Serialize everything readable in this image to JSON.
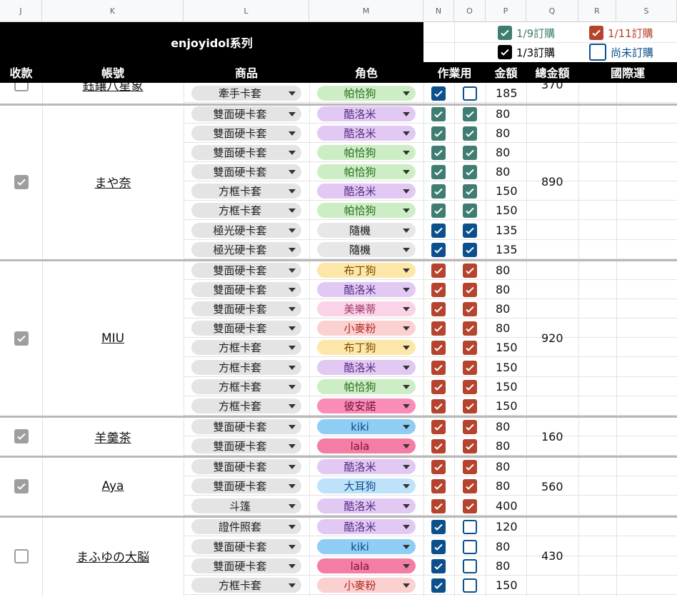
{
  "columns": [
    "J",
    "K",
    "L",
    "M",
    "N",
    "O",
    "P",
    "Q",
    "R",
    "S"
  ],
  "title": "enjoyidol系列",
  "legend": [
    {
      "label": "1/9訂購",
      "color": "#3f7d73",
      "state": "checked"
    },
    {
      "label": "1/11訂購",
      "color": "#b5432d",
      "state": "checked"
    },
    {
      "label": "1/3訂購",
      "color": "#000000",
      "state": "checked"
    },
    {
      "label": "尚未訂購",
      "color": "#0b4f8c",
      "state": "unchecked"
    }
  ],
  "headers": {
    "paid": "收款",
    "account": "帳號",
    "product": "商品",
    "character": "角色",
    "work": "作業用",
    "amount": "金額",
    "total": "總金額",
    "intl": "國際運"
  },
  "rows": [
    {
      "product": "牽手卡套",
      "character": "帕恰狗",
      "n": "blue-on",
      "o": "blue-off",
      "amount": "185"
    },
    {
      "product": "雙面硬卡套",
      "character": "酷洛米",
      "n": "teal-on",
      "o": "teal-on",
      "amount": "80"
    },
    {
      "product": "雙面硬卡套",
      "character": "酷洛米",
      "n": "teal-on",
      "o": "teal-on",
      "amount": "80"
    },
    {
      "product": "雙面硬卡套",
      "character": "帕恰狗",
      "n": "teal-on",
      "o": "teal-on",
      "amount": "80"
    },
    {
      "product": "雙面硬卡套",
      "character": "帕恰狗",
      "n": "teal-on",
      "o": "teal-on",
      "amount": "80"
    },
    {
      "product": "方框卡套",
      "character": "酷洛米",
      "n": "teal-on",
      "o": "teal-on",
      "amount": "150"
    },
    {
      "product": "方框卡套",
      "character": "帕恰狗",
      "n": "teal-on",
      "o": "teal-on",
      "amount": "150"
    },
    {
      "product": "極光硬卡套",
      "character": "隨機",
      "n": "blue-on",
      "o": "blue-on",
      "amount": "135"
    },
    {
      "product": "極光硬卡套",
      "character": "隨機",
      "n": "blue-on",
      "o": "blue-on",
      "amount": "135"
    },
    {
      "product": "雙面硬卡套",
      "character": "布丁狗",
      "n": "red-on",
      "o": "red-on",
      "amount": "80"
    },
    {
      "product": "雙面硬卡套",
      "character": "酷洛米",
      "n": "red-on",
      "o": "red-on",
      "amount": "80"
    },
    {
      "product": "雙面硬卡套",
      "character": "美樂蒂",
      "n": "red-on",
      "o": "red-on",
      "amount": "80"
    },
    {
      "product": "雙面硬卡套",
      "character": "小麥粉",
      "n": "red-on",
      "o": "red-on",
      "amount": "80"
    },
    {
      "product": "方框卡套",
      "character": "布丁狗",
      "n": "red-on",
      "o": "red-on",
      "amount": "150"
    },
    {
      "product": "方框卡套",
      "character": "酷洛米",
      "n": "red-on",
      "o": "red-on",
      "amount": "150"
    },
    {
      "product": "方框卡套",
      "character": "帕恰狗",
      "n": "red-on",
      "o": "red-on",
      "amount": "150"
    },
    {
      "product": "方框卡套",
      "character": "彼安諾",
      "n": "red-on",
      "o": "red-on",
      "amount": "150"
    },
    {
      "product": "雙面硬卡套",
      "character": "kiki",
      "n": "red-on",
      "o": "red-on",
      "amount": "80"
    },
    {
      "product": "雙面硬卡套",
      "character": "lala",
      "n": "red-on",
      "o": "red-on",
      "amount": "80"
    },
    {
      "product": "雙面硬卡套",
      "character": "酷洛米",
      "n": "red-on",
      "o": "red-on",
      "amount": "80"
    },
    {
      "product": "雙面硬卡套",
      "character": "大耳狗",
      "n": "red-on",
      "o": "red-on",
      "amount": "80"
    },
    {
      "product": "斗篷",
      "character": "酷洛米",
      "n": "red-on",
      "o": "red-on",
      "amount": "400"
    },
    {
      "product": "證件照套",
      "character": "酷洛米",
      "n": "blue-on",
      "o": "blue-off",
      "amount": "120"
    },
    {
      "product": "雙面硬卡套",
      "character": "kiki",
      "n": "blue-on",
      "o": "blue-off",
      "amount": "80"
    },
    {
      "product": "雙面硬卡套",
      "character": "lala",
      "n": "blue-on",
      "o": "blue-off",
      "amount": "80"
    },
    {
      "product": "方框卡套",
      "character": "小麥粉",
      "n": "blue-on",
      "o": "blue-off",
      "amount": "150"
    }
  ],
  "groups": [
    {
      "account": "鈺鑲八星象",
      "paid": false,
      "total": "370"
    },
    {
      "account": "まや奈",
      "paid": true,
      "total": "890"
    },
    {
      "account": "MIU",
      "paid": true,
      "total": "920"
    },
    {
      "account": "羊羹茶",
      "paid": true,
      "total": "160"
    },
    {
      "account": "Aya",
      "paid": true,
      "total": "560"
    },
    {
      "account": "まふゆの大脳",
      "paid": false,
      "total": "430"
    }
  ],
  "chip_colors": {
    "帕恰狗": "c-pa",
    "酷洛米": "c-qiao",
    "隨機": "c-rand",
    "布丁狗": "c-bu",
    "美樂蒂": "c-mei",
    "小麥粉": "c-xiao",
    "彼安諾": "c-bi",
    "kiki": "c-kiki",
    "lala": "c-lala",
    "大耳狗": "c-da"
  },
  "icons": {
    "checkbox": "checkbox-icon",
    "dropdown": "chevron-down-icon"
  }
}
